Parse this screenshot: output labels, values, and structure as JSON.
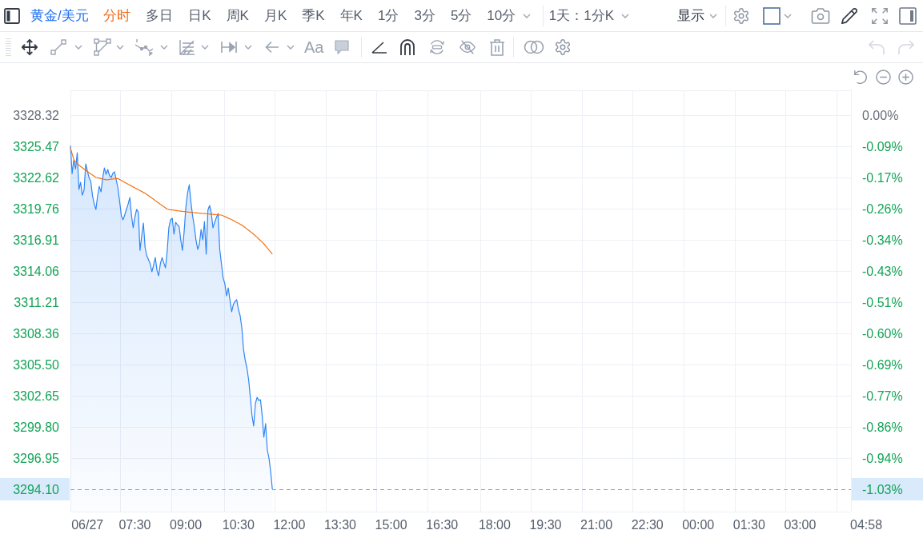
{
  "toolbar": {
    "symbol": "黄金/美元",
    "periods": [
      {
        "label": "分时",
        "selected": true,
        "has_menu": false
      },
      {
        "label": "多日",
        "selected": false,
        "has_menu": false
      },
      {
        "label": "日K",
        "selected": false,
        "has_menu": false
      },
      {
        "label": "周K",
        "selected": false,
        "has_menu": false
      },
      {
        "label": "月K",
        "selected": false,
        "has_menu": false
      },
      {
        "label": "季K",
        "selected": false,
        "has_menu": false
      },
      {
        "label": "年K",
        "selected": false,
        "has_menu": false
      },
      {
        "label": "1分",
        "selected": false,
        "has_menu": false
      },
      {
        "label": "3分",
        "selected": false,
        "has_menu": false
      },
      {
        "label": "5分",
        "selected": false,
        "has_menu": false
      },
      {
        "label": "10分",
        "selected": false,
        "has_menu": true
      }
    ],
    "interval": "1天：1分K",
    "display_menu": "显示"
  },
  "drawing_toolbar": {
    "text_tool": "Aa",
    "undo": {
      "disabled": true
    },
    "redo": {
      "disabled": true
    }
  },
  "chart": {
    "chart_data": {
      "type": "area",
      "grid": true,
      "categories": [
        null,
        null,
        null,
        null,
        null,
        null,
        null,
        null,
        null,
        null,
        "06/27",
        null,
        null,
        null,
        null,
        null,
        null,
        null,
        null,
        null,
        null,
        null,
        null,
        null,
        null,
        null,
        null,
        null,
        null,
        null,
        null,
        null,
        null,
        null,
        null,
        null,
        null,
        null,
        "07:30",
        null,
        null,
        null,
        null,
        null,
        null,
        null,
        null,
        null,
        null,
        null,
        null,
        null,
        null,
        null,
        null,
        null,
        null,
        null,
        null,
        null,
        null,
        null,
        null,
        null,
        null,
        null,
        null,
        null,
        "09:00",
        null,
        null,
        null,
        null,
        null,
        null,
        null,
        null,
        null,
        null,
        null,
        null,
        null,
        null,
        null,
        null,
        null,
        null,
        null,
        null,
        null,
        null,
        null,
        null,
        null,
        null,
        null,
        null,
        null,
        null,
        "10:30",
        null,
        null,
        null,
        null,
        null,
        null,
        null,
        null,
        null,
        null,
        null,
        null,
        null,
        null,
        null,
        null,
        null,
        null,
        null,
        null,
        null,
        null,
        null,
        null,
        null,
        null,
        null,
        null,
        null,
        "12:00",
        null,
        null,
        null,
        null,
        null,
        null,
        null,
        null,
        null,
        null,
        null,
        null,
        null,
        null,
        null,
        null,
        null,
        null,
        null,
        null,
        null,
        null,
        null,
        null,
        null,
        null,
        null,
        null,
        null,
        "13:30",
        null,
        null,
        null,
        null,
        null,
        null,
        null,
        null,
        null,
        null,
        null,
        null,
        null,
        null,
        null,
        null,
        null,
        null,
        null,
        null,
        null,
        null,
        null,
        null,
        null,
        null,
        null,
        null,
        null,
        "15:00",
        null,
        null,
        null,
        null,
        null,
        null,
        null,
        null,
        null,
        null,
        null,
        null,
        null,
        null,
        null,
        null,
        null,
        null,
        null,
        null,
        null,
        null,
        null,
        null,
        null,
        null,
        null,
        null,
        null,
        "16:30",
        null,
        null,
        null,
        null,
        null,
        null,
        null,
        null,
        null,
        null,
        null,
        null,
        null,
        null,
        null,
        null,
        null,
        null,
        null,
        null,
        null,
        null,
        null,
        null,
        null,
        null,
        null,
        null,
        null,
        null,
        "18:00",
        null,
        null,
        null,
        null,
        null,
        null,
        null,
        null,
        null,
        null,
        null,
        null,
        null,
        null,
        null,
        null,
        null,
        null,
        null,
        null,
        null,
        null,
        null,
        null,
        null,
        null,
        null,
        null,
        null,
        "19:30",
        null,
        null,
        null,
        null,
        null,
        null,
        null,
        null,
        null,
        null,
        null,
        null,
        null,
        null,
        null,
        null,
        null,
        null,
        null,
        null,
        null,
        null,
        null,
        null,
        null,
        null,
        null,
        null,
        null,
        "21:00",
        null,
        null,
        null,
        null,
        null,
        null,
        null,
        null,
        null,
        null,
        null,
        null,
        null,
        null,
        null,
        null,
        null,
        null,
        null,
        null,
        null,
        null,
        null,
        null,
        null,
        null,
        null,
        null,
        null,
        "22:30",
        null,
        null,
        null,
        null,
        null,
        null,
        null,
        null,
        null,
        null,
        null,
        null,
        null,
        null,
        null,
        null,
        null,
        null,
        null,
        null,
        null,
        null,
        null,
        null,
        null,
        null,
        null,
        null,
        null,
        "00:00",
        null,
        null,
        null,
        null,
        null,
        null,
        null,
        null,
        null,
        null,
        null,
        null,
        null,
        null,
        null,
        null,
        null,
        null,
        null,
        null,
        null,
        null,
        null,
        null,
        null,
        null,
        null,
        null,
        null,
        "01:30",
        null,
        null,
        null,
        null,
        null,
        null,
        null,
        null,
        null,
        null,
        null,
        null,
        null,
        null,
        null,
        null,
        null,
        null,
        null,
        null,
        null,
        null,
        null,
        null,
        null,
        null,
        null,
        null,
        null,
        "03:00",
        null,
        null,
        null,
        null,
        null,
        null,
        null,
        null,
        null,
        null,
        null,
        null,
        null,
        null,
        null,
        null,
        null,
        null,
        null,
        null,
        null,
        null,
        null,
        null,
        null,
        null,
        null,
        null,
        null,
        null,
        null,
        null,
        null,
        null,
        null,
        null,
        null,
        null,
        "04:58"
      ],
      "series": [
        {
          "color": "#2f86f6",
          "values": [
            3325.54,
            3322.98,
            3324.2,
            3323.4,
            3324.88,
            3321.52,
            3322.18,
            3321.0,
            3321.45,
            3323.86,
            3323.2,
            3322.6,
            3322.25,
            3320.93,
            3320.2,
            3319.69,
            3320.9,
            3321.81,
            3321.3,
            3322.6,
            3323.49,
            3322.91,
            3323.35,
            3322.8,
            3322.62,
            3323.0,
            3323.13,
            3322.4,
            3321.67,
            3320.4,
            3319.11,
            3318.74,
            3319.2,
            3319.69,
            3320.2,
            3320.79,
            3319.11,
            3318.01,
            3319.0,
            3319.69,
            3319.47,
            3315.96,
            3317.28,
            3318.45,
            3316.18,
            3315.45,
            3315.1,
            3314.72,
            3313.99,
            3314.6,
            3315.3,
            3314.13,
            3313.62,
            3314.72,
            3315.3,
            3314.8,
            3314.35,
            3315.82,
            3318.01,
            3318.74,
            3318.89,
            3317.43,
            3318.52,
            3318.3,
            3318.16,
            3316.91,
            3315.96,
            3317.64,
            3319.84,
            3321.2,
            3321.96,
            3320.35,
            3319.11,
            3318.16,
            3316.91,
            3316.04,
            3316.55,
            3317.86,
            3316.91,
            3318.59,
            3315.6,
            3319.62,
            3320.06,
            3319.4,
            3318.01,
            3318.5,
            3318.96,
            3319.33,
            3316.04,
            3314.72,
            3313.4,
            3312.89,
            3311.79,
            3312.53,
            3311.43,
            3310.33,
            3311.0,
            3311.28,
            3311.43,
            3310.55,
            3309.97,
            3308.87,
            3306.9,
            3305.9,
            3305.21,
            3304.12,
            3302.51,
            3300.83,
            3299.88,
            3301.92,
            3302.51,
            3302.22,
            3302.29,
            3300.83,
            3298.85,
            3300.1,
            3297.68,
            3296.95,
            3295.71,
            3294.1,
            null,
            null,
            null,
            null,
            null,
            null,
            null,
            null,
            null,
            null,
            null,
            null,
            null,
            null,
            null,
            null,
            null,
            null,
            null,
            null,
            null,
            null,
            null,
            null,
            null,
            null,
            null,
            null,
            null,
            null,
            null,
            null,
            null,
            null,
            null,
            null,
            null,
            null,
            null,
            null,
            null,
            null,
            null,
            null,
            null,
            null,
            null,
            null,
            null,
            null,
            null,
            null,
            null,
            null,
            null,
            null,
            null,
            null,
            null,
            null,
            null,
            null,
            null,
            null,
            null,
            null,
            null,
            null,
            null,
            null,
            null,
            null,
            null,
            null,
            null,
            null,
            null,
            null,
            null,
            null,
            null,
            null,
            null,
            null,
            null,
            null,
            null,
            null,
            null,
            null,
            null,
            null,
            null,
            null,
            null,
            null,
            null,
            null,
            null,
            null,
            null,
            null,
            null,
            null,
            null,
            null,
            null,
            null,
            null,
            null,
            null,
            null,
            null,
            null,
            null,
            null,
            null,
            null,
            null,
            null,
            null,
            null,
            null,
            null,
            null,
            null,
            null,
            null,
            null,
            null,
            null,
            null,
            null,
            null,
            null,
            null,
            null,
            null,
            null,
            null,
            null,
            null,
            null,
            null,
            null,
            null,
            null,
            null,
            null,
            null,
            null,
            null,
            null,
            null,
            null,
            null,
            null,
            null,
            null,
            null,
            null,
            null,
            null,
            null,
            null,
            null,
            null,
            null,
            null,
            null,
            null,
            null,
            null,
            null,
            null,
            null,
            null,
            null,
            null,
            null,
            null,
            null,
            null,
            null,
            null,
            null,
            null,
            null,
            null,
            null,
            null,
            null,
            null,
            null,
            null,
            null,
            null,
            null,
            null,
            null,
            null,
            null,
            null,
            null,
            null,
            null,
            null,
            null,
            null,
            null,
            null,
            null,
            null,
            null,
            null,
            null,
            null,
            null,
            null,
            null,
            null,
            null,
            null,
            null,
            null,
            null,
            null,
            null,
            null,
            null,
            null,
            null,
            null,
            null,
            null,
            null,
            null,
            null,
            null,
            null,
            null,
            null,
            null,
            null,
            null,
            null,
            null,
            null,
            null,
            null,
            null,
            null,
            null,
            null,
            null,
            null,
            null,
            null,
            null,
            null,
            null,
            null,
            null,
            null,
            null,
            null,
            null,
            null,
            null,
            null,
            null,
            null,
            null,
            null,
            null,
            null,
            null,
            null,
            null,
            null,
            null,
            null,
            null,
            null,
            null,
            null,
            null,
            null,
            null,
            null,
            null,
            null,
            null,
            null,
            null,
            null,
            null,
            null,
            null,
            null,
            null,
            null,
            null,
            null,
            null,
            null,
            null,
            null,
            null,
            null,
            null,
            null,
            null,
            null,
            null,
            null,
            null,
            null,
            null,
            null,
            null,
            null,
            null,
            null,
            null,
            null,
            null,
            null,
            null,
            null,
            null,
            null,
            null,
            null,
            null,
            null,
            null,
            null,
            null,
            null,
            null,
            null,
            null,
            null,
            null,
            null,
            null,
            null,
            null,
            null
          ]
        },
        {
          "type": "line",
          "color": "#f27318",
          "values": [
            3325.32,
            3324.79,
            3324.26,
            3324.0,
            3323.88,
            3323.76,
            3323.63,
            3323.51,
            3323.39,
            3323.27,
            3323.16,
            3323.05,
            3322.95,
            3322.84,
            3322.73,
            3322.62,
            3322.59,
            3322.55,
            3322.52,
            3322.49,
            3322.45,
            3322.41,
            3322.41,
            3322.44,
            3322.46,
            3322.48,
            3322.5,
            3322.53,
            3322.51,
            3322.43,
            3322.34,
            3322.26,
            3322.17,
            3322.09,
            3322.0,
            3321.92,
            3321.84,
            3321.75,
            3321.67,
            3321.59,
            3321.51,
            3321.42,
            3321.34,
            3321.26,
            3321.18,
            3321.07,
            3320.96,
            3320.85,
            3320.73,
            3320.62,
            3320.5,
            3320.39,
            3320.28,
            3320.16,
            3320.05,
            3319.95,
            3319.84,
            3319.73,
            3319.68,
            3319.66,
            3319.64,
            3319.62,
            3319.6,
            3319.58,
            3319.56,
            3319.54,
            3319.52,
            3319.5,
            3319.48,
            3319.46,
            3319.45,
            3319.43,
            3319.42,
            3319.4,
            3319.39,
            3319.37,
            3319.36,
            3319.34,
            3319.33,
            3319.31,
            3319.3,
            3319.29,
            3319.27,
            3319.26,
            3319.25,
            3319.23,
            3319.22,
            3319.21,
            3319.19,
            3319.18,
            3319.11,
            3319.04,
            3318.97,
            3318.9,
            3318.83,
            3318.76,
            3318.68,
            3318.6,
            3318.51,
            3318.43,
            3318.34,
            3318.26,
            3318.15,
            3318.03,
            3317.91,
            3317.79,
            3317.67,
            3317.55,
            3317.43,
            3317.28,
            3317.14,
            3316.99,
            3316.84,
            3316.7,
            3316.55,
            3316.36,
            3316.17,
            3315.98,
            3315.8,
            3315.61,
            null,
            null,
            null,
            null,
            null,
            null,
            null,
            null,
            null,
            null,
            null,
            null,
            null,
            null,
            null,
            null,
            null,
            null,
            null,
            null,
            null,
            null,
            null,
            null,
            null,
            null,
            null,
            null,
            null,
            null,
            null,
            null,
            null,
            null,
            null,
            null,
            null,
            null,
            null,
            null,
            null,
            null,
            null,
            null,
            null,
            null,
            null,
            null,
            null,
            null,
            null,
            null,
            null,
            null,
            null,
            null,
            null,
            null,
            null,
            null,
            null,
            null,
            null,
            null,
            null,
            null,
            null,
            null,
            null,
            null,
            null,
            null,
            null,
            null,
            null,
            null,
            null,
            null,
            null,
            null,
            null,
            null,
            null,
            null,
            null,
            null,
            null,
            null,
            null,
            null,
            null,
            null,
            null,
            null,
            null,
            null,
            null,
            null,
            null,
            null,
            null,
            null,
            null,
            null,
            null,
            null,
            null,
            null,
            null,
            null,
            null,
            null,
            null,
            null,
            null,
            null,
            null,
            null,
            null,
            null,
            null,
            null,
            null,
            null,
            null,
            null,
            null,
            null,
            null,
            null,
            null,
            null,
            null,
            null,
            null,
            null,
            null,
            null,
            null,
            null,
            null,
            null,
            null,
            null,
            null,
            null,
            null,
            null,
            null,
            null,
            null,
            null,
            null,
            null,
            null,
            null,
            null,
            null,
            null,
            null,
            null,
            null,
            null,
            null,
            null,
            null,
            null,
            null,
            null,
            null,
            null,
            null,
            null,
            null,
            null,
            null,
            null,
            null,
            null,
            null,
            null,
            null,
            null,
            null,
            null,
            null,
            null,
            null,
            null,
            null,
            null,
            null,
            null,
            null,
            null,
            null,
            null,
            null,
            null,
            null,
            null,
            null,
            null,
            null,
            null,
            null,
            null,
            null,
            null,
            null,
            null,
            null,
            null,
            null,
            null,
            null,
            null,
            null,
            null,
            null,
            null,
            null,
            null,
            null,
            null,
            null,
            null,
            null,
            null,
            null,
            null,
            null,
            null,
            null,
            null,
            null,
            null,
            null,
            null,
            null,
            null,
            null,
            null,
            null,
            null,
            null,
            null,
            null,
            null,
            null,
            null,
            null,
            null,
            null,
            null,
            null,
            null,
            null,
            null,
            null,
            null,
            null,
            null,
            null,
            null,
            null,
            null,
            null,
            null,
            null,
            null,
            null,
            null,
            null,
            null,
            null,
            null,
            null,
            null,
            null,
            null,
            null,
            null,
            null,
            null,
            null,
            null,
            null,
            null,
            null,
            null,
            null,
            null,
            null,
            null,
            null,
            null,
            null,
            null,
            null,
            null,
            null,
            null,
            null,
            null,
            null,
            null,
            null,
            null,
            null,
            null,
            null,
            null,
            null,
            null,
            null,
            null,
            null,
            null,
            null,
            null,
            null,
            null,
            null,
            null,
            null,
            null,
            null,
            null,
            null,
            null,
            null,
            null,
            null,
            null,
            null,
            null,
            null,
            null,
            null,
            null,
            null,
            null,
            null,
            null,
            null,
            null,
            null,
            null,
            null
          ]
        }
      ],
      "ylim": [
        3292.05,
        3330.59
      ],
      "yticks": [
        {
          "value": 3328.32,
          "label": "3328.32"
        },
        {
          "value": 3325.47,
          "label": "3325.47"
        },
        {
          "value": 3322.62,
          "label": "3322.62"
        },
        {
          "value": 3319.76,
          "label": "3319.76"
        },
        {
          "value": 3316.91,
          "label": "3316.91"
        },
        {
          "value": 3314.06,
          "label": "3314.06"
        },
        {
          "value": 3311.21,
          "label": "3311.21"
        },
        {
          "value": 3308.36,
          "label": "3308.36"
        },
        {
          "value": 3305.5,
          "label": "3305.50"
        },
        {
          "value": 3302.65,
          "label": "3302.65"
        },
        {
          "value": 3299.8,
          "label": "3299.80"
        },
        {
          "value": 3296.95,
          "label": "3296.95"
        }
      ],
      "ref_lines": [
        {
          "axis": "y",
          "value": 3294.1,
          "label": "3294.10",
          "color": "#e88a52"
        }
      ]
    },
    "percent_axis": [
      {
        "label": "0.00%",
        "color": "#666e7a"
      },
      {
        "label": "-0.09%",
        "color": "#13a456"
      },
      {
        "label": "-0.17%",
        "color": "#13a456"
      },
      {
        "label": "-0.26%",
        "color": "#13a456"
      },
      {
        "label": "-0.34%",
        "color": "#13a456"
      },
      {
        "label": "-0.43%",
        "color": "#13a456"
      },
      {
        "label": "-0.51%",
        "color": "#13a456"
      },
      {
        "label": "-0.60%",
        "color": "#13a456"
      },
      {
        "label": "-0.69%",
        "color": "#13a456"
      },
      {
        "label": "-0.77%",
        "color": "#13a456"
      },
      {
        "label": "-0.86%",
        "color": "#13a456"
      },
      {
        "label": "-0.94%",
        "color": "#13a456"
      }
    ],
    "last_percent": {
      "label": "-1.03%",
      "color": "#13a456"
    }
  }
}
